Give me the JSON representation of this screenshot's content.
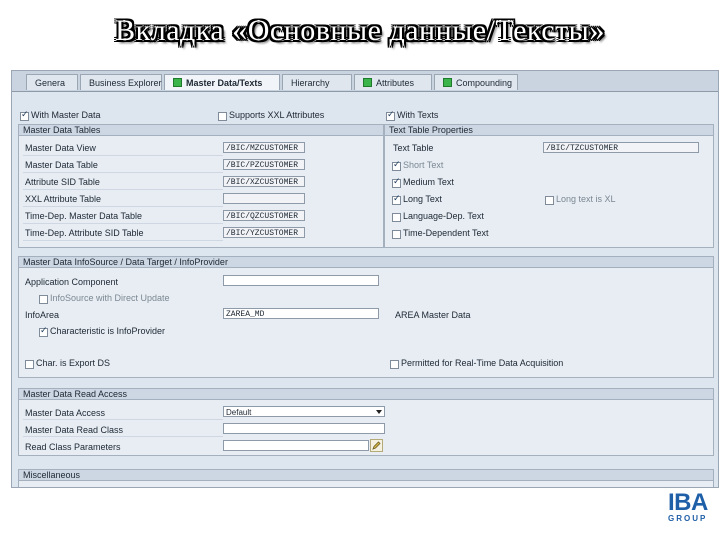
{
  "page_title": "Вкладка «Основные данные/Тексты»",
  "tabs": [
    {
      "label": "Genera",
      "status_icon": false
    },
    {
      "label": "Business Explorer",
      "status_icon": false
    },
    {
      "label": "Master Data/Texts",
      "status_icon": true
    },
    {
      "label": "Hierarchy",
      "status_icon": false
    },
    {
      "label": "Attributes",
      "status_icon": true
    },
    {
      "label": "Compounding",
      "status_icon": true
    }
  ],
  "top_checks": {
    "with_master_data": {
      "label": "With Master Data",
      "checked": true
    },
    "supports_xxl": {
      "label": "Supports XXL Attributes",
      "checked": false
    },
    "with_texts": {
      "label": "With Texts",
      "checked": true
    }
  },
  "master_tables": {
    "header": "Master Data Tables",
    "rows": [
      {
        "label": "Master Data View",
        "value": "/BIC/MZCUSTOMER"
      },
      {
        "label": "Master Data Table",
        "value": "/BIC/PZCUSTOMER"
      },
      {
        "label": "Attribute SID Table",
        "value": "/BIC/XZCUSTOMER"
      },
      {
        "label": "XXL Attribute Table",
        "value": ""
      },
      {
        "label": "Time-Dep. Master Data Table",
        "value": "/BIC/QZCUSTOMER"
      },
      {
        "label": "Time-Dep. Attribute SID Table",
        "value": "/BIC/YZCUSTOMER"
      }
    ]
  },
  "text_props": {
    "header": "Text Table Properties",
    "text_table_label": "Text Table",
    "text_table_value": "/BIC/TZCUSTOMER",
    "checks": [
      {
        "label": "Short Text",
        "checked": true,
        "enabled": false
      },
      {
        "label": "Medium Text",
        "checked": true,
        "enabled": true
      },
      {
        "label": "Long Text",
        "checked": true,
        "enabled": true
      },
      {
        "label": "Language-Dep. Text",
        "checked": false,
        "enabled": true
      },
      {
        "label": "Time-Dependent Text",
        "checked": false,
        "enabled": true
      }
    ],
    "long_xl": {
      "label": "Long text is XL",
      "checked": false
    }
  },
  "infosource": {
    "header": "Master Data InfoSource / Data Target / InfoProvider",
    "app_component_label": "Application Component",
    "app_component_value": "",
    "direct_update": {
      "label": "InfoSource with Direct Update",
      "checked": false
    },
    "infoarea_label": "InfoArea",
    "infoarea_value": "ZAREA_MD",
    "infoarea_desc": "AREA Master Data",
    "char_provider": {
      "label": "Characteristic is InfoProvider",
      "checked": true
    },
    "export_ds": {
      "label": "Char. is Export DS",
      "checked": false
    },
    "realtime": {
      "label": "Permitted for Real-Time Data Acquisition",
      "checked": false
    }
  },
  "read_access": {
    "header": "Master Data Read Access",
    "access_label": "Master Data Access",
    "access_value": "Default",
    "read_class_label": "Master Data Read Class",
    "read_class_value": "",
    "params_label": "Read Class Parameters",
    "params_value": ""
  },
  "misc": {
    "header": "Miscellaneous"
  },
  "logo": {
    "main": "IBA",
    "sub": "GROUP",
    "color": "#1f5fa8"
  },
  "colors": {
    "status_green": "#3bb44a",
    "panel": "#dde5ee"
  }
}
